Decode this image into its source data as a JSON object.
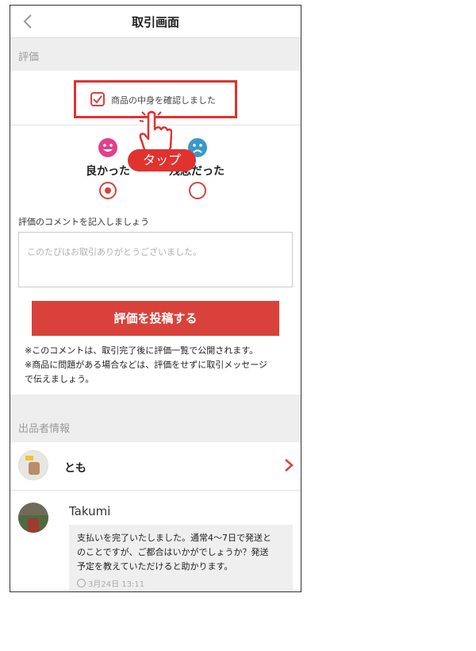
{
  "header": {
    "title": "取引画面"
  },
  "evaluation_section": {
    "label": "評価"
  },
  "confirm": {
    "label": "商品の中身を確認しました",
    "checked": true
  },
  "ratings": [
    {
      "label": "良かった",
      "selected": true,
      "color": "#e0418a"
    },
    {
      "label": "残念だった",
      "selected": false,
      "color": "#3a98c9"
    }
  ],
  "annotation": {
    "tap_label": "タップ"
  },
  "comment": {
    "label": "評価のコメントを記入しましょう",
    "placeholder": "このたびはお取引ありがとうございました。"
  },
  "submit": {
    "label": "評価を投稿する"
  },
  "notes": [
    "※このコメントは、取引完了後に評価一覧で公開されます。",
    "※商品に問題がある場合などは、評価をせずに取引メッセージ",
    "で伝えましょう。"
  ],
  "seller_section": {
    "label": "出品者情報"
  },
  "seller": {
    "name": "とも"
  },
  "message": {
    "sender": "Takumi",
    "lines": [
      "支払いを完了いたしました。通常4〜7日で発送と",
      "のことですが、ご都合はいかがでしょうか？発送",
      "予定を教えていただけると助かります。"
    ],
    "time": "3月24日 13:11"
  },
  "colors": {
    "accent": "#d9423b",
    "highlight": "#e0322f",
    "section_bg": "#eeeeee"
  }
}
